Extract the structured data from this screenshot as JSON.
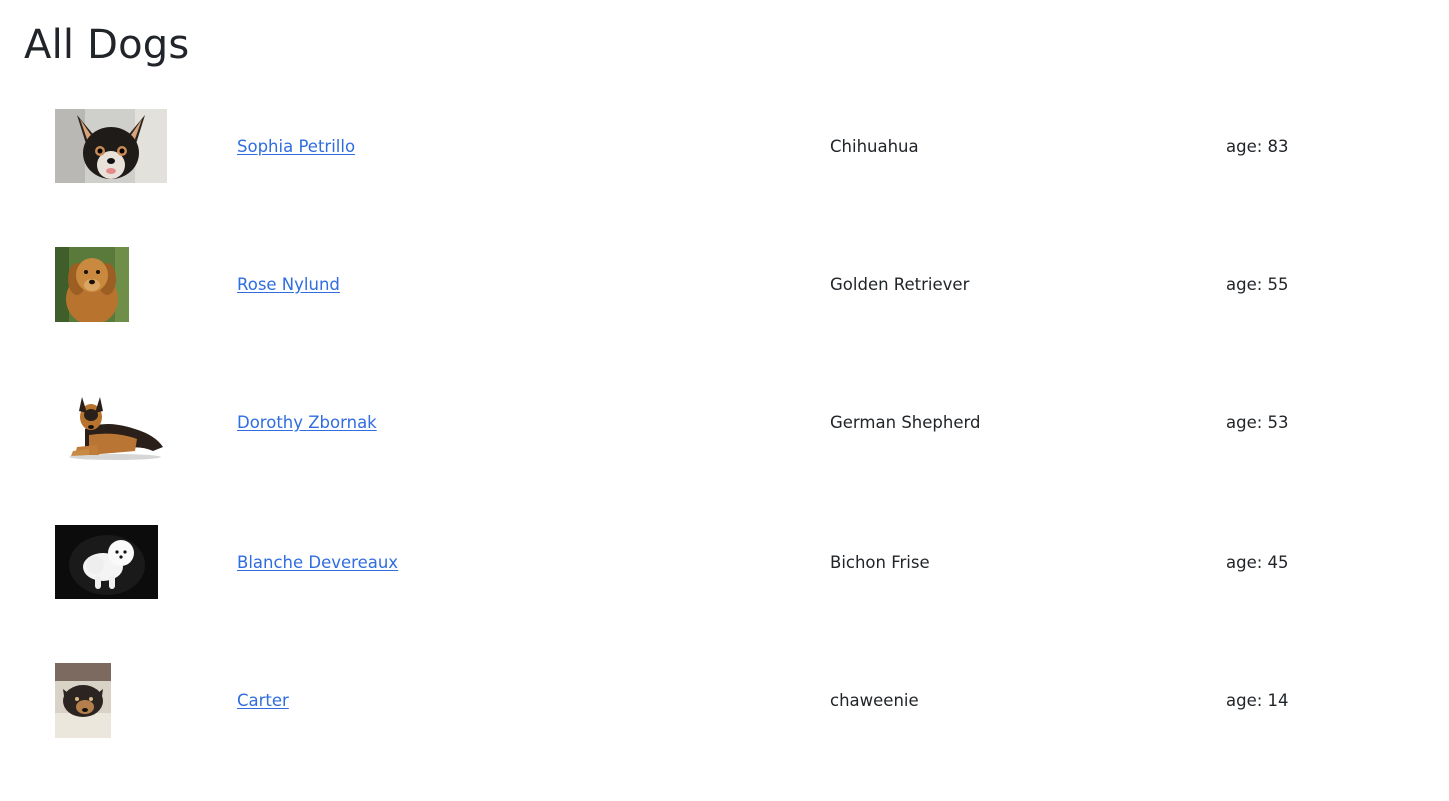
{
  "page": {
    "title": "All Dogs"
  },
  "dogs": [
    {
      "name": "Sophia Petrillo",
      "breed": "Chihuahua",
      "age_text": "age: 83",
      "photo_icon": "chihuahua-photo"
    },
    {
      "name": "Rose Nylund",
      "breed": "Golden Retriever",
      "age_text": "age: 55",
      "photo_icon": "golden-retriever-photo"
    },
    {
      "name": "Dorothy Zbornak",
      "breed": "German Shepherd",
      "age_text": "age: 53",
      "photo_icon": "german-shepherd-photo"
    },
    {
      "name": "Blanche Devereaux",
      "breed": "Bichon Frise",
      "age_text": "age: 45",
      "photo_icon": "bichon-frise-photo"
    },
    {
      "name": "Carter",
      "breed": "chaweenie",
      "age_text": "age: 14",
      "photo_icon": "chaweenie-photo"
    }
  ],
  "colors": {
    "link": "#2f6de0",
    "text": "#212529",
    "background": "#ffffff"
  }
}
